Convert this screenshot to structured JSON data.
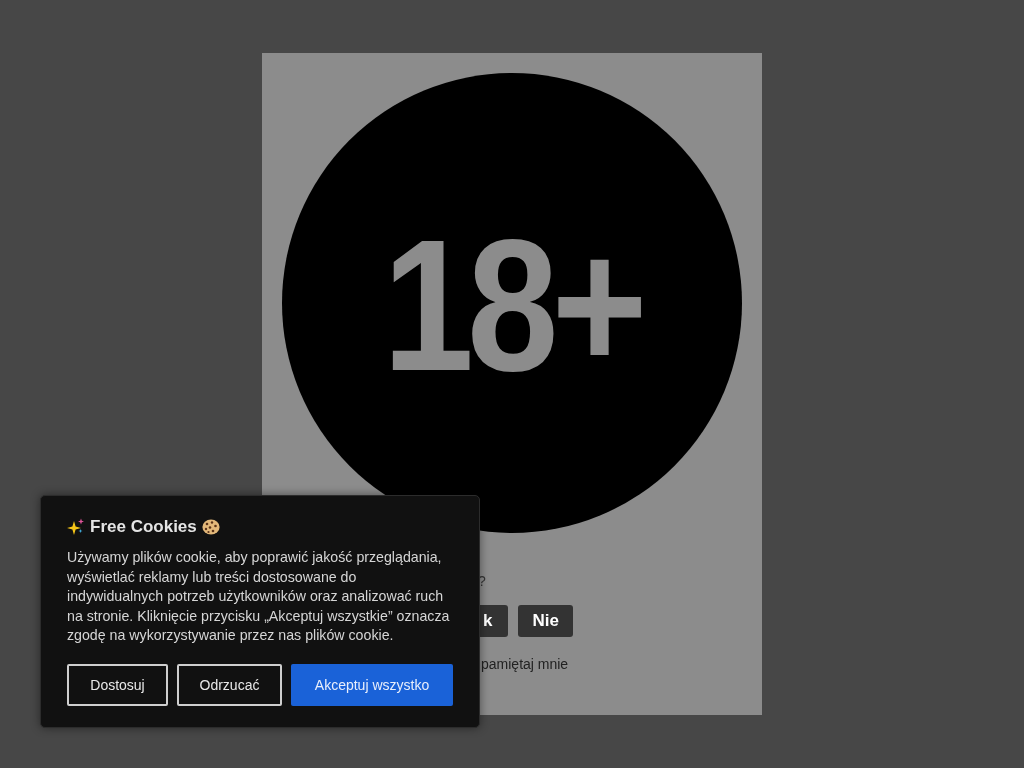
{
  "age_gate": {
    "badge": "18+",
    "question": "?",
    "buttons": [
      {
        "label": "k"
      },
      {
        "label": "Nie"
      }
    ],
    "remember_label": "pamiętaj mnie"
  },
  "cookie_banner": {
    "title": "Free Cookies",
    "text": "Używamy plików cookie, aby poprawić jakość przeglądania, wyświetlać reklamy lub treści dostosowane do indywidualnych potrzeb użytkowników oraz analizować ruch na stronie. Kliknięcie przycisku „Akceptuj wszystkie” oznacza zgodę na wykorzystywanie przez nas plików cookie.",
    "buttons": [
      {
        "label": "Dostosuj",
        "kind": "outline"
      },
      {
        "label": "Odrzucać",
        "kind": "outline"
      },
      {
        "label": "Akceptuj wszystko",
        "kind": "primary"
      }
    ]
  }
}
